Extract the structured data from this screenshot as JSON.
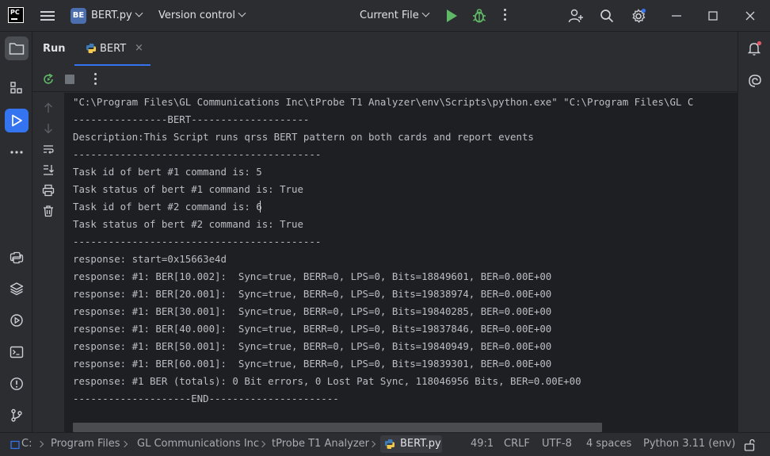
{
  "titlebar": {
    "app_logo_text": "PC",
    "project_badge": "BE",
    "project_name": "BERT.py",
    "vcs_label": "Version control",
    "run_config": "Current File"
  },
  "toolwindow": {
    "title": "Run",
    "tab_label": "BERT",
    "tab_close": "×"
  },
  "console": {
    "lines": [
      "\"C:\\Program Files\\GL Communications Inc\\tProbe T1 Analyzer\\env\\Scripts\\python.exe\" \"C:\\Program Files\\GL C",
      "----------------BERT--------------------",
      "Description:This Script runs qrss BERT pattern on both cards and report events",
      "------------------------------------------",
      "Task id of bert #1 command is: 5",
      "Task status of bert #1 command is: True",
      "Task id of bert #2 command is: 6",
      "Task status of bert #2 command is: True",
      "------------------------------------------",
      "response: start=0x15663e4d",
      "response: #1: BER[10.002]:  Sync=true, BERR=0, LPS=0, Bits=18849601, BER=0.00E+00",
      "response: #1: BER[20.001]:  Sync=true, BERR=0, LPS=0, Bits=19838974, BER=0.00E+00",
      "response: #1: BER[30.001]:  Sync=true, BERR=0, LPS=0, Bits=19840285, BER=0.00E+00",
      "response: #1: BER[40.000]:  Sync=true, BERR=0, LPS=0, Bits=19837846, BER=0.00E+00",
      "response: #1: BER[50.001]:  Sync=true, BERR=0, LPS=0, Bits=19840949, BER=0.00E+00",
      "response: #1: BER[60.001]:  Sync=true, BERR=0, LPS=0, Bits=19839301, BER=0.00E+00",
      "response: #1 BER (totals): 0 Bit errors, 0 Lost Pat Sync, 118046956 Bits, BER=0.00E+00",
      "--------------------END----------------------"
    ]
  },
  "statusbar": {
    "breadcrumbs": [
      "C:",
      "Program Files",
      "GL Communications Inc",
      "tProbe T1 Analyzer",
      "BERT.py"
    ],
    "position": "49:1",
    "line_separator": "CRLF",
    "encoding": "UTF-8",
    "indent": "4 spaces",
    "interpreter": "Python 3.11 (env)"
  },
  "colors": {
    "accent": "#3574f0",
    "run_green": "#5fb865",
    "python_blue": "#3d7ab8",
    "python_yellow": "#f2c94c"
  }
}
